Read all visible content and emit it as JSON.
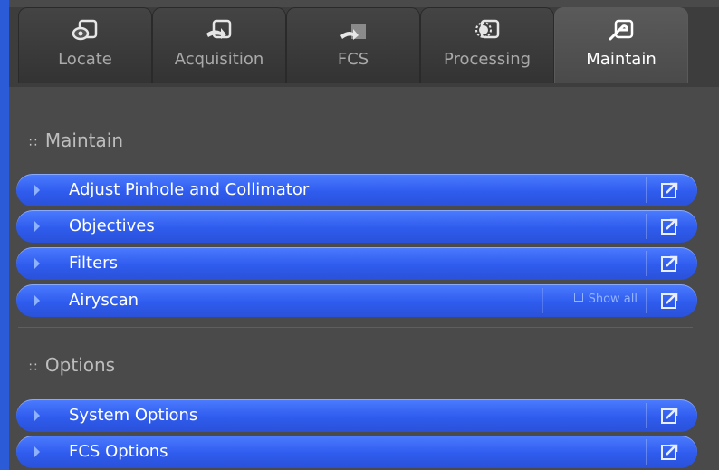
{
  "tabs": [
    {
      "label": "Locate",
      "icon": "locate-icon"
    },
    {
      "label": "Acquisition",
      "icon": "acquisition-icon"
    },
    {
      "label": "FCS",
      "icon": "fcs-icon"
    },
    {
      "label": "Processing",
      "icon": "processing-icon"
    },
    {
      "label": "Maintain",
      "icon": "maintain-icon",
      "active": true
    }
  ],
  "sections": {
    "maintain": {
      "title": "Maintain",
      "items": [
        {
          "label": "Adjust Pinhole and Collimator"
        },
        {
          "label": "Objectives"
        },
        {
          "label": "Filters"
        },
        {
          "label": "Airyscan",
          "show_all": "Show all"
        }
      ]
    },
    "options": {
      "title": "Options",
      "items": [
        {
          "label": "System Options"
        },
        {
          "label": "FCS Options"
        }
      ]
    }
  },
  "colors": {
    "accent": "#2f5cee",
    "panel": "#4a4a4a",
    "background": "#2b5bd6"
  }
}
